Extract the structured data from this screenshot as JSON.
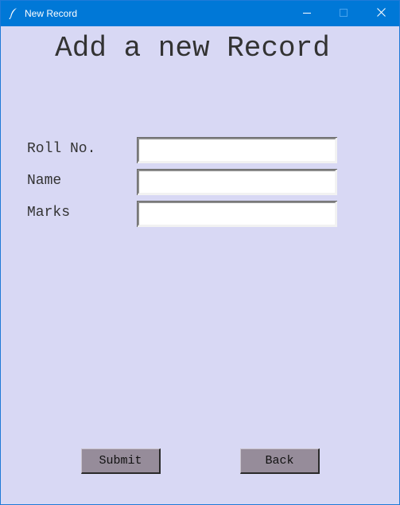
{
  "window": {
    "title": "New Record",
    "app_icon": "feather-icon",
    "controls": {
      "minimize": "minimize-icon",
      "maximize": "maximize-icon",
      "close": "close-icon"
    }
  },
  "form": {
    "heading": "Add a new Record",
    "fields": [
      {
        "label": "Roll No.",
        "value": "",
        "placeholder": ""
      },
      {
        "label": "Name",
        "value": "",
        "placeholder": ""
      },
      {
        "label": "Marks",
        "value": "",
        "placeholder": ""
      }
    ]
  },
  "buttons": {
    "submit_label": "Submit",
    "back_label": "Back"
  },
  "colors": {
    "titlebar": "#0078d7",
    "background": "#d8d8f4",
    "button": "#968c9a",
    "text": "#333333"
  }
}
